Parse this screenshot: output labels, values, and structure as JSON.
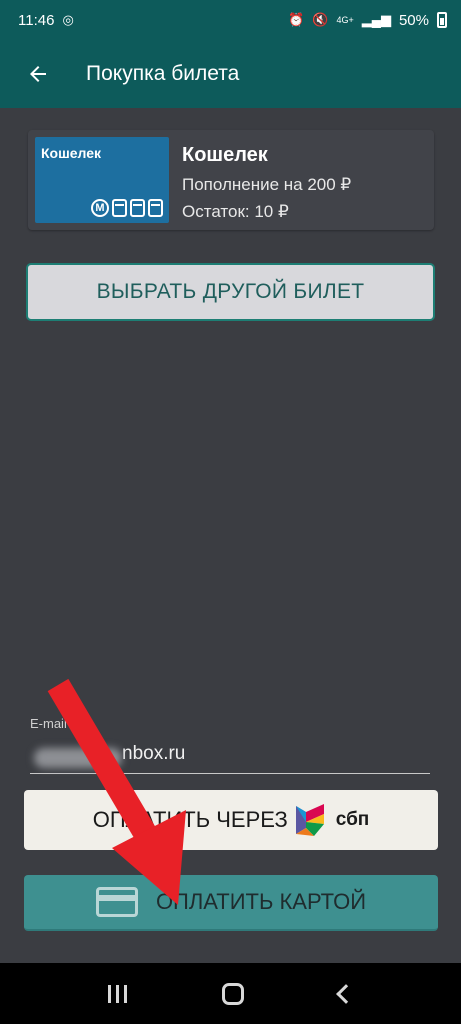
{
  "status_bar": {
    "time": "11:46",
    "network": "4G+",
    "battery": "50%"
  },
  "app_bar": {
    "title": "Покупка билета"
  },
  "ticket": {
    "image_label": "Кошелек",
    "title": "Кошелек",
    "line1": "Пополнение на 200 ₽",
    "line2": "Остаток: 10 ₽"
  },
  "actions": {
    "choose_other": "ВЫБРАТЬ ДРУГОЙ БИЛЕТ",
    "pay_sbp": "ОПЛАТИТЬ ЧЕРЕЗ",
    "sbp_logo_text": "сбп",
    "pay_card": "ОПЛАТИТЬ КАРТОЙ"
  },
  "email": {
    "label": "E-mail",
    "value": "nbox.ru"
  },
  "icons": {
    "back": "arrow-left-icon",
    "card": "credit-card-icon",
    "annotation": "red-arrow"
  },
  "colors": {
    "toolbar": "#0d5b5b",
    "background": "#3b3d42",
    "card_button": "#3e9090",
    "annotation_arrow": "#e82127"
  }
}
